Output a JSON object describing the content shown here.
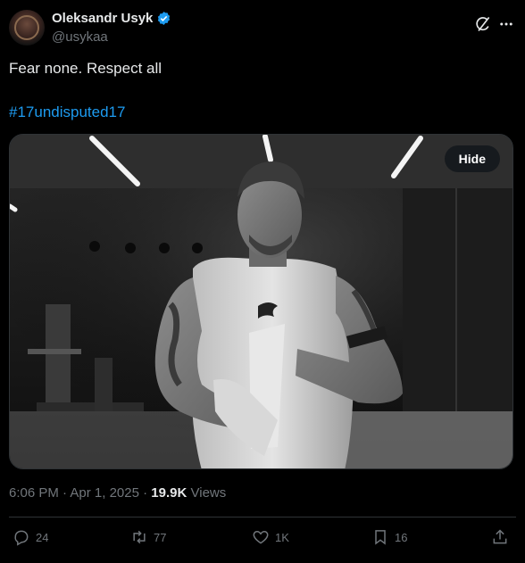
{
  "author": {
    "display_name": "Oleksandr Usyk",
    "handle": "@usykaa",
    "verified": true
  },
  "tweet": {
    "text": "Fear none. Respect all",
    "hashtag": "#17undisputed17"
  },
  "media": {
    "hide_label": "Hide",
    "description_icon": "grayscale-photo"
  },
  "meta": {
    "time": "6:06 PM",
    "separator": "·",
    "date": "Apr 1, 2025",
    "views_count": "19.9K",
    "views_label": "Views"
  },
  "actions": {
    "replies": "24",
    "reposts": "77",
    "likes": "1K",
    "bookmarks": "16"
  },
  "colors": {
    "background": "#000000",
    "text": "#e7e9ea",
    "muted": "#71767b",
    "link": "#1d9bf0",
    "verified": "#1d9bf0",
    "divider": "#2f3336"
  }
}
